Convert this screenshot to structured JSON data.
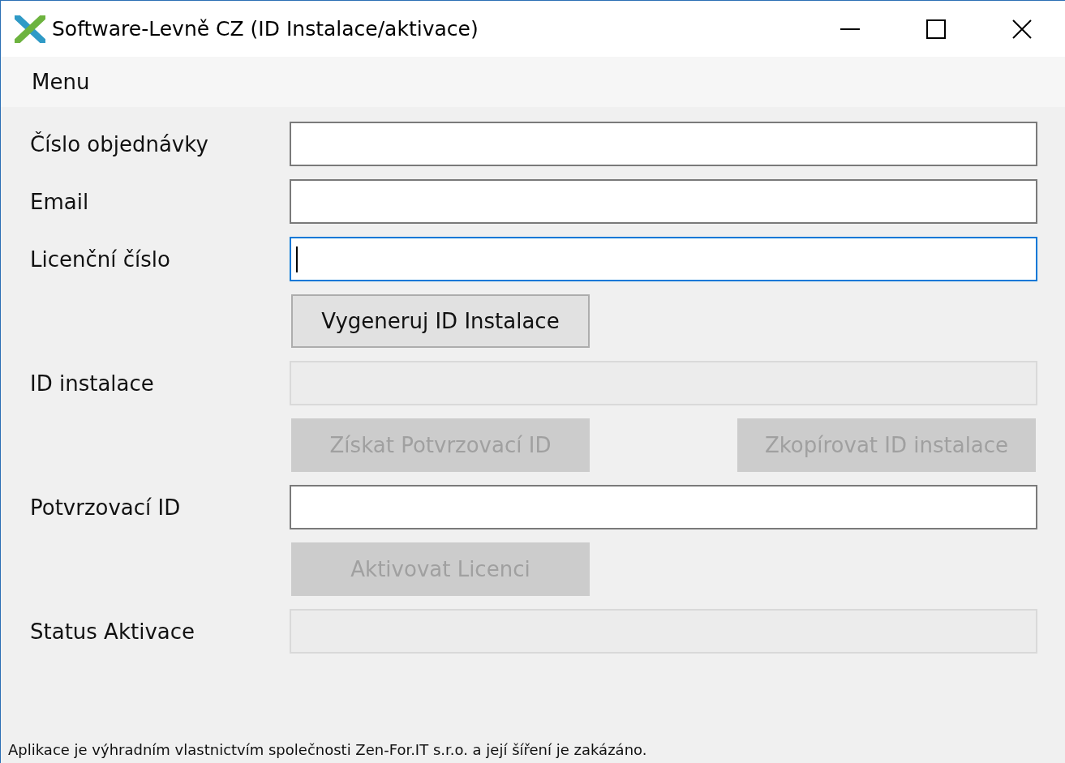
{
  "window": {
    "title": "Software-Levně CZ (ID Instalace/aktivace)"
  },
  "menu": {
    "items": [
      "Menu"
    ]
  },
  "form": [
    {
      "kind": "field",
      "label": "Číslo objednávky",
      "disabled": false,
      "focused": false
    },
    {
      "kind": "field",
      "label": "Email",
      "disabled": false,
      "focused": false
    },
    {
      "kind": "field",
      "label": "Licenční číslo",
      "disabled": false,
      "focused": true
    },
    {
      "kind": "buttons",
      "buttons": [
        {
          "label": "Vygeneruj ID Instalace",
          "disabled": false
        }
      ]
    },
    {
      "kind": "field",
      "label": "ID instalace",
      "disabled": true,
      "focused": false
    },
    {
      "kind": "buttons",
      "buttons": [
        {
          "label": "Získat Potvrzovací ID",
          "disabled": true
        },
        {
          "label": "Zkopírovat ID instalace",
          "disabled": true
        }
      ]
    },
    {
      "kind": "field",
      "label": "Potvrzovací ID",
      "disabled": false,
      "focused": false
    },
    {
      "kind": "buttons",
      "buttons": [
        {
          "label": "Aktivovat Licenci",
          "disabled": true
        }
      ]
    },
    {
      "kind": "field",
      "label": "Status Aktivace",
      "disabled": true,
      "focused": false
    }
  ],
  "footer": "Aplikace je výhradním vlastnictvím společnosti Zen-For.IT s.r.o. a její šíření je zakázáno."
}
